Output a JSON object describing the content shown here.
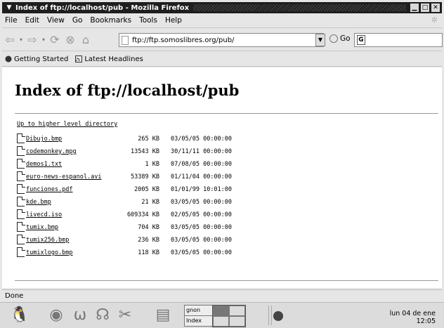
{
  "window": {
    "title": "Index of ftp://localhost/pub - Mozilla Firefox",
    "buttons": [
      "minimize",
      "maximize",
      "close"
    ]
  },
  "menu": {
    "items": [
      "File",
      "Edit",
      "View",
      "Go",
      "Bookmarks",
      "Tools",
      "Help"
    ]
  },
  "toolbar": {
    "url": "ftp://ftp.somoslibres.org/pub/",
    "go_label": "Go",
    "icons": [
      "back-icon",
      "forward-icon",
      "reload-icon",
      "stop-icon",
      "home-icon"
    ]
  },
  "bookmarks": {
    "items": [
      "Getting Started",
      "Latest Headlines"
    ]
  },
  "page": {
    "heading": "Index of ftp://localhost/pub",
    "up_link": "Up to higher level directory",
    "files": [
      {
        "name": "Dibujo.bmp",
        "size": "265 KB",
        "date": "03/05/05",
        "time": "00:00:00"
      },
      {
        "name": "codemonkey.mpg",
        "size": "13543 KB",
        "date": "30/11/11",
        "time": "00:00:00"
      },
      {
        "name": "demos1.txt",
        "size": "1 KB",
        "date": "07/08/05",
        "time": "00:00:00"
      },
      {
        "name": "euro-news-espanol.avi",
        "size": "53389 KB",
        "date": "01/11/04",
        "time": "00:00:00"
      },
      {
        "name": "funciones.pdf",
        "size": "2005 KB",
        "date": "01/01/99",
        "time": "10:01:00"
      },
      {
        "name": "kde.bmp",
        "size": "21 KB",
        "date": "03/05/05",
        "time": "00:00:00"
      },
      {
        "name": "livecd.iso",
        "size": "609334 KB",
        "date": "02/05/05",
        "time": "00:00:00"
      },
      {
        "name": "tumix.bmp",
        "size": "704 KB",
        "date": "03/05/05",
        "time": "00:00:00"
      },
      {
        "name": "tumix256.bmp",
        "size": "236 KB",
        "date": "03/05/05",
        "time": "00:00:00"
      },
      {
        "name": "tumixlogo.bmp",
        "size": "118 KB",
        "date": "03/05/05",
        "time": "00:00:00"
      }
    ]
  },
  "status": {
    "text": "Done"
  },
  "taskbar": {
    "tasks": [
      "gnon",
      "Index"
    ],
    "clock_date": "lun 04 de ene",
    "clock_time": "12:05"
  }
}
